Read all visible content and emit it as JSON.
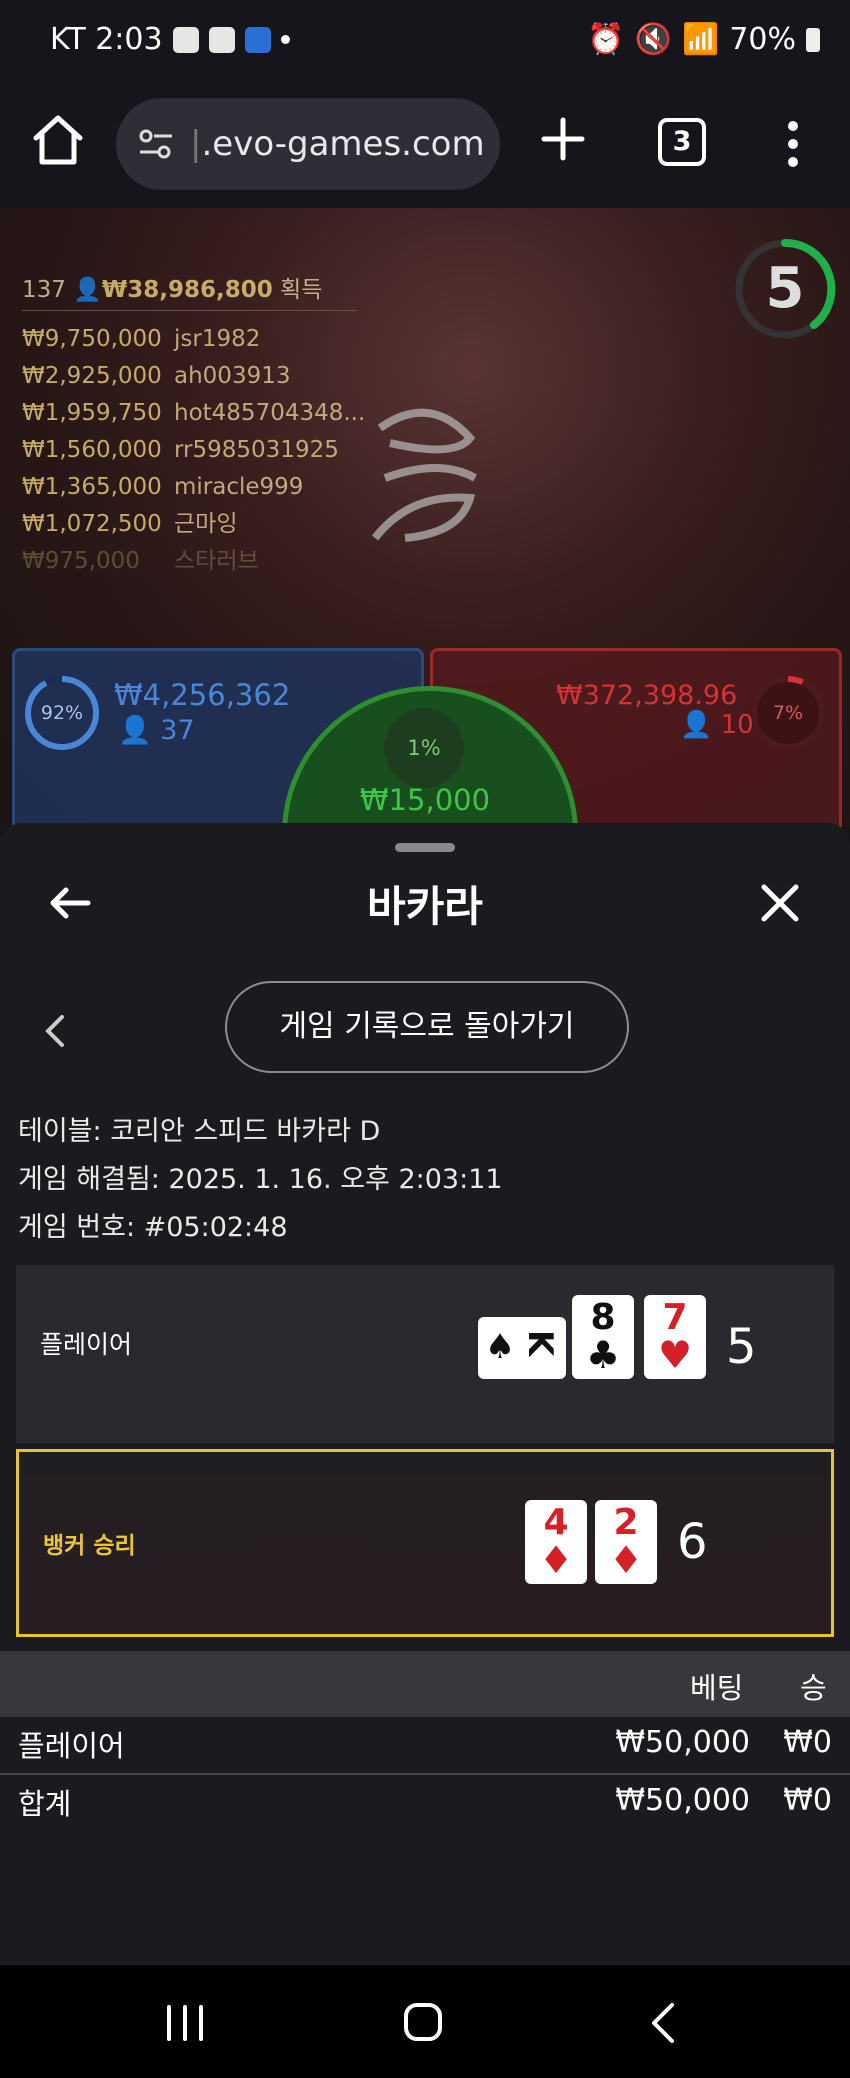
{
  "status_bar": {
    "carrier_time": "KT 2:03",
    "battery": "70%"
  },
  "browser": {
    "url_faded": "|",
    "url": ".evo-games.com",
    "tab_count": "3"
  },
  "game": {
    "timer": "5",
    "winners_count": "137",
    "winners_total": "₩38,986,800",
    "winners_suffix": "획득",
    "winners": [
      {
        "amount": "₩9,750,000",
        "name": "jsr1982"
      },
      {
        "amount": "₩2,925,000",
        "name": "ah003913"
      },
      {
        "amount": "₩1,959,750",
        "name": "hot485704348..."
      },
      {
        "amount": "₩1,560,000",
        "name": "rr5985031925"
      },
      {
        "amount": "₩1,365,000",
        "name": "miracle999"
      },
      {
        "amount": "₩1,072,500",
        "name": "근마잉"
      },
      {
        "amount": "₩975,000",
        "name": "스타러브"
      }
    ],
    "player_bet": {
      "percent": "92%",
      "amount": "₩4,256,362",
      "count": "37"
    },
    "banker_bet": {
      "percent": "7%",
      "amount": "₩372,398.96",
      "count": "10"
    },
    "tie_bet": {
      "percent": "1%",
      "amount": "₩15,000"
    }
  },
  "sheet": {
    "title": "바카라",
    "history_button": "게임 기록으로 돌아가기",
    "info": {
      "table": "테이블: 코리안 스피드 바카라 D",
      "resolved": "게임 해결됨: 2025. 1. 16. 오후 2:03:11",
      "game_no": "게임 번호: #05:02:48"
    },
    "player_hand": {
      "label": "플레이어",
      "cards": [
        {
          "rank": "K",
          "suit": "♠"
        },
        {
          "rank": "8",
          "suit": "♣"
        },
        {
          "rank": "7",
          "suit": "♥"
        }
      ],
      "score": "5"
    },
    "banker_hand": {
      "label": "뱅커 승리",
      "cards": [
        {
          "rank": "4",
          "suit": "♦"
        },
        {
          "rank": "2",
          "suit": "♦"
        }
      ],
      "score": "6"
    },
    "bets_table": {
      "headers": {
        "bet": "베팅",
        "win": "승"
      },
      "rows": [
        {
          "label": "플레이어",
          "bet": "₩50,000",
          "win": "₩0"
        },
        {
          "label": "합계",
          "bet": "₩50,000",
          "win": "₩0"
        }
      ]
    }
  },
  "colors": {
    "accent_gold": "#e2c437",
    "player_blue": "#2c5696",
    "banker_red": "#c92f35",
    "tie_green": "#2f8f2e"
  }
}
